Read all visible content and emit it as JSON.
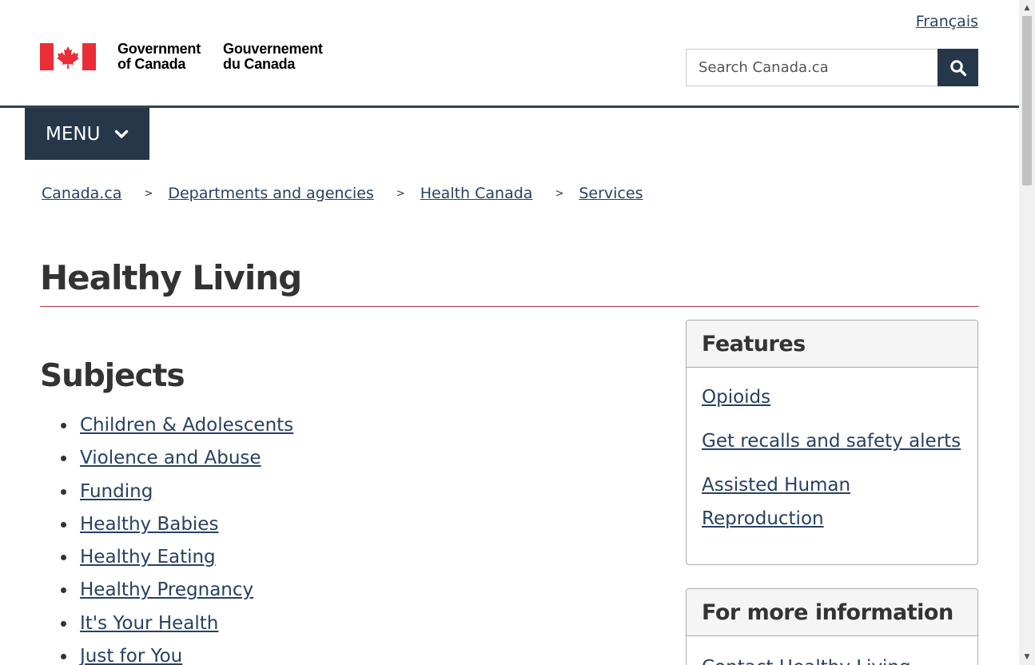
{
  "header": {
    "language_link": "Français",
    "signature_en_line1": "Government",
    "signature_en_line2": "of Canada",
    "signature_fr_line1": "Gouvernement",
    "signature_fr_line2": "du Canada",
    "search_placeholder": "Search Canada.ca",
    "search_icon": "search-icon"
  },
  "menu": {
    "label": "MENU",
    "icon": "chevron-down-icon"
  },
  "breadcrumb": [
    {
      "label": "Canada.ca"
    },
    {
      "label": "Departments and agencies"
    },
    {
      "label": "Health Canada"
    },
    {
      "label": "Services"
    }
  ],
  "page": {
    "title": "Healthy Living"
  },
  "subjects": {
    "heading": "Subjects",
    "items": [
      "Children & Adolescents",
      "Violence and Abuse",
      "Funding",
      "Healthy Babies",
      "Healthy Eating",
      "Healthy Pregnancy",
      "It's Your Health",
      "Just for You"
    ]
  },
  "features": {
    "heading": "Features",
    "items": [
      "Opioids",
      "Get recalls and safety alerts",
      "Assisted Human Reproduction"
    ]
  },
  "more_info": {
    "heading": "For more information",
    "items": [
      "Contact Healthy Living"
    ]
  },
  "colors": {
    "brand_dark": "#26374a",
    "link": "#284162",
    "title_rule": "#af3c43",
    "flag_red": "#eb2d37"
  }
}
